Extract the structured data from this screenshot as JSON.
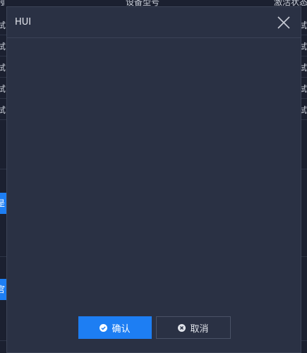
{
  "background": {
    "header": {
      "left": "號",
      "middle": "设备型号",
      "right": "激活状态"
    },
    "rows": [
      {
        "left": "试",
        "right": "试"
      },
      {
        "left": "试",
        "right": "试"
      },
      {
        "left": "试",
        "right": "试"
      },
      {
        "left": "试",
        "right": "试"
      },
      {
        "left": "试",
        "right": "试"
      }
    ],
    "chips": [
      "是",
      "官"
    ]
  },
  "modal": {
    "title": "HUI",
    "close_icon": "close-icon",
    "confirm_label": "确认",
    "confirm_icon": "check-circle-icon",
    "cancel_label": "取消",
    "cancel_icon": "x-circle-icon"
  },
  "colors": {
    "page_bg": "#1b2030",
    "modal_bg": "#2a3144",
    "primary": "#1d7ef3",
    "text": "#e6e8ee"
  }
}
